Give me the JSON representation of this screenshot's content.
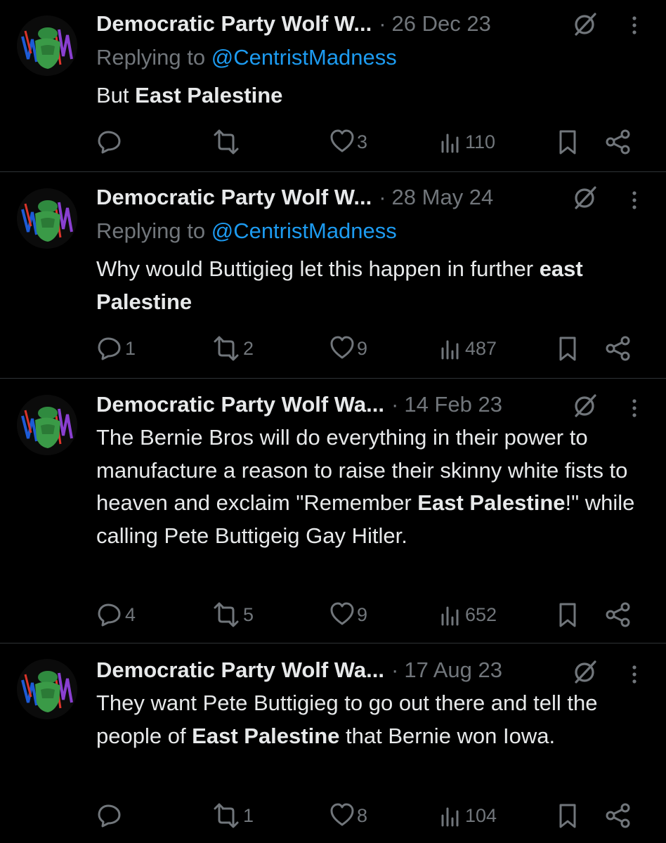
{
  "tweets": [
    {
      "name": "Democratic Party Wolf W...",
      "date": "26 Dec 23",
      "replying_prefix": "Replying to ",
      "replying_handle": "@CentristMadness",
      "text_segments": [
        {
          "t": "But ",
          "b": false
        },
        {
          "t": "East Palestine",
          "b": true
        }
      ],
      "counts": {
        "reply": "",
        "retweet": "",
        "like": "3",
        "views": "110"
      }
    },
    {
      "name": "Democratic Party Wolf W...",
      "date": "28 May 24",
      "replying_prefix": "Replying to ",
      "replying_handle": "@CentristMadness",
      "text_segments": [
        {
          "t": "Why would Buttigieg let this happen in further ",
          "b": false
        },
        {
          "t": "east Palestine",
          "b": true
        }
      ],
      "counts": {
        "reply": "1",
        "retweet": "2",
        "like": "9",
        "views": "487"
      }
    },
    {
      "name": "Democratic Party Wolf Wa...",
      "date": "14 Feb 23",
      "replying_prefix": "",
      "replying_handle": "",
      "text_segments": [
        {
          "t": "The Bernie Bros will do everything in their power to manufacture a reason to raise their skinny white fists to heaven and exclaim \"Remember ",
          "b": false
        },
        {
          "t": "East Palestine",
          "b": true
        },
        {
          "t": "!\" while calling Pete Buttigeig Gay Hitler.",
          "b": false
        }
      ],
      "counts": {
        "reply": "4",
        "retweet": "5",
        "like": "9",
        "views": "652"
      }
    },
    {
      "name": "Democratic Party Wolf Wa...",
      "date": "17 Aug 23",
      "replying_prefix": "",
      "replying_handle": "",
      "text_segments": [
        {
          "t": "They want Pete Buttigieg to go out there and tell the people of ",
          "b": false
        },
        {
          "t": "East Palestine",
          "b": true
        },
        {
          "t": " that Bernie won Iowa.",
          "b": false
        }
      ],
      "counts": {
        "reply": "",
        "retweet": "1",
        "like": "8",
        "views": "104"
      }
    }
  ],
  "colors": {
    "background": "#000000",
    "text": "#e7e9ea",
    "muted": "#71767b",
    "link": "#1d9bf0",
    "divider": "#2f3336"
  },
  "icons": [
    "avatar",
    "grok-icon",
    "more-icon",
    "reply-icon",
    "retweet-icon",
    "like-icon",
    "views-icon",
    "bookmark-icon",
    "share-icon"
  ]
}
